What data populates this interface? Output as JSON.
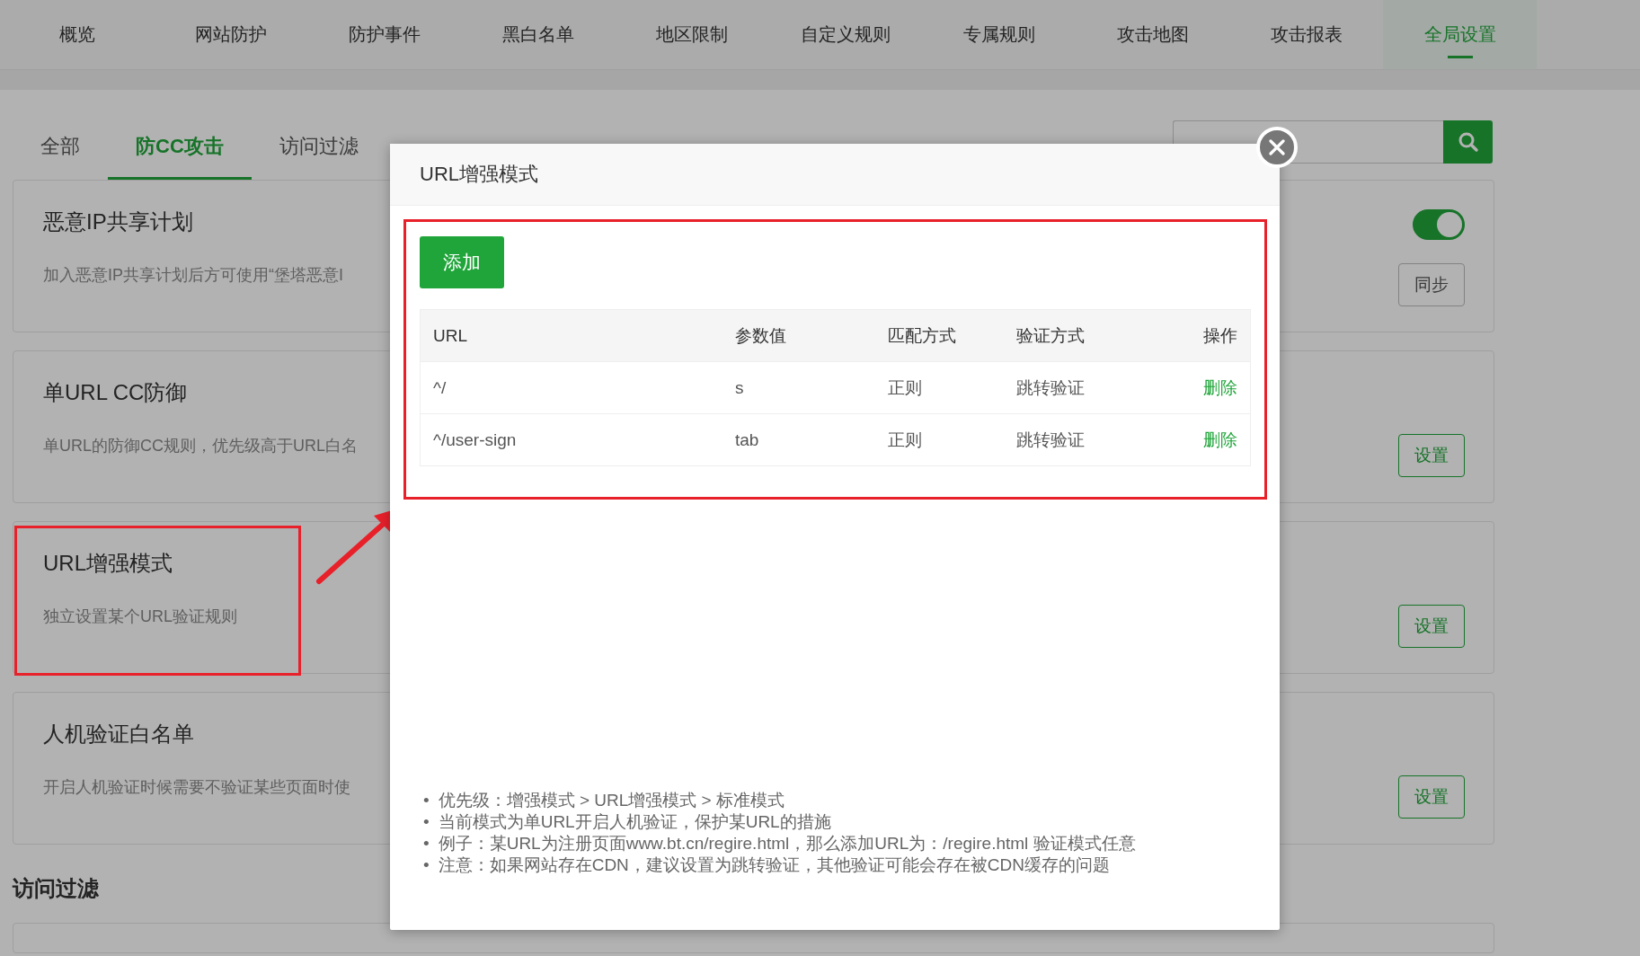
{
  "nav": {
    "items": [
      {
        "label": "概览",
        "selected": false
      },
      {
        "label": "网站防护",
        "selected": false
      },
      {
        "label": "防护事件",
        "selected": false
      },
      {
        "label": "黑白名单",
        "selected": false
      },
      {
        "label": "地区限制",
        "selected": false
      },
      {
        "label": "自定义规则",
        "selected": false
      },
      {
        "label": "专属规则",
        "selected": false
      },
      {
        "label": "攻击地图",
        "selected": false
      },
      {
        "label": "攻击报表",
        "selected": false
      },
      {
        "label": "全局设置",
        "selected": true
      }
    ]
  },
  "subtabs": [
    {
      "label": "全部",
      "selected": false
    },
    {
      "label": "防CC攻击",
      "selected": true
    },
    {
      "label": "访问过滤",
      "selected": false
    }
  ],
  "cards": [
    {
      "title": "恶意IP共享计划",
      "description": "加入恶意IP共享计划后方可使用“堡塔恶意I",
      "controls": [
        {
          "kind": "toggle",
          "on": true
        },
        {
          "kind": "secondary",
          "label": "同步"
        }
      ]
    },
    {
      "title": "单URL CC防御",
      "description": "单URL的防御CC规则，优先级高于URL白名",
      "controls": [
        {
          "kind": "primary",
          "label": "设置"
        }
      ]
    },
    {
      "title": "URL增强模式",
      "description": "独立设置某个URL验证规则",
      "controls": [
        {
          "kind": "primary",
          "label": "设置"
        }
      ]
    },
    {
      "title": "人机验证白名单",
      "description": "开启人机验证时候需要不验证某些页面时使",
      "controls": [
        {
          "kind": "primary",
          "label": "设置"
        }
      ]
    }
  ],
  "section_heading": "访问过滤",
  "modal": {
    "title": "URL增强模式",
    "add_button": "添加",
    "table": {
      "columns": [
        "URL",
        "参数值",
        "匹配方式",
        "验证方式",
        "操作"
      ],
      "rows": [
        {
          "url": "^/",
          "param": "s",
          "match": "正则",
          "verify": "跳转验证",
          "action": "删除"
        },
        {
          "url": "^/user-sign",
          "param": "tab",
          "match": "正则",
          "verify": "跳转验证",
          "action": "删除"
        }
      ]
    },
    "bullet": "•",
    "notes": [
      "优先级：增强模式 > URL增强模式 > 标准模式",
      "当前模式为单URL开启人机验证，保护某URL的措施",
      "例子：某URL为注册页面www.bt.cn/regire.html，那么添加URL为：/regire.html 验证模式任意",
      "注意：如果网站存在CDN，建议设置为跳转验证，其他验证可能会存在被CDN缓存的问题"
    ]
  }
}
